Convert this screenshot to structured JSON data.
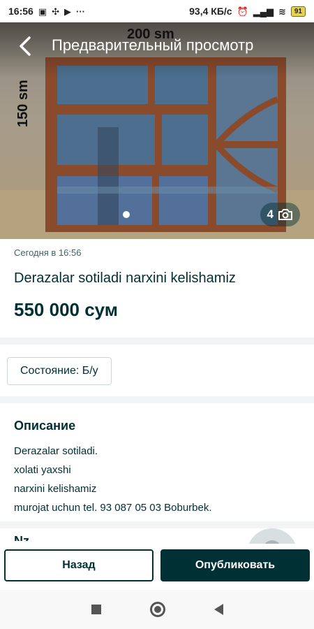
{
  "status_bar": {
    "time": "16:56",
    "left_icons": [
      "sim-icon",
      "sync-icon",
      "youtube-icon",
      "more-dots-icon"
    ],
    "net_speed": "93,4 КБ/с",
    "battery": "91"
  },
  "header": {
    "title": "Предварительный просмотр",
    "back_icon": "chevron-left-icon"
  },
  "photo": {
    "count": "4",
    "camera_icon": "camera-icon",
    "overlay_width_text": "200 sm",
    "overlay_height_text": "150 sm"
  },
  "listing": {
    "date": "Сегодня в 16:56",
    "title": "Derazalar sotiladi narxini kelishamiz",
    "price": "550 000 сум",
    "condition_tag": "Состояние: Б/у"
  },
  "description": {
    "heading": "Описание",
    "lines": [
      "Derazalar sotiladi.",
      "xolati yaxshi",
      "narxini kelishamiz",
      "murojat uchun tel. 93 087 05 03 Boburbek."
    ]
  },
  "seller": {
    "heading_cut": "Nz..."
  },
  "actions": {
    "back_label": "Назад",
    "publish_label": "Опубликовать"
  },
  "colors": {
    "brand_dark": "#002f34",
    "separator": "#f2f4f5"
  }
}
